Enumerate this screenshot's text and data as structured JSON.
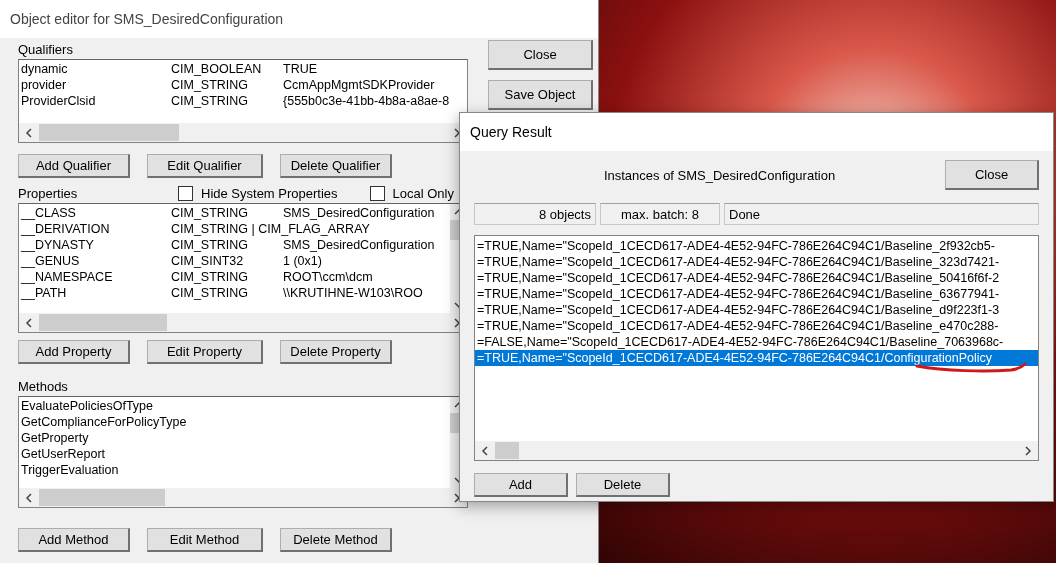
{
  "editor": {
    "title": "Object editor for SMS_DesiredConfiguration",
    "side_buttons": [
      "Close",
      "Save Object"
    ],
    "qualifiers": {
      "label": "Qualifiers",
      "rows": [
        {
          "name": "dynamic",
          "type": "CIM_BOOLEAN",
          "value": "TRUE"
        },
        {
          "name": "provider",
          "type": "CIM_STRING",
          "value": "CcmAppMgmtSDKProvider"
        },
        {
          "name": "ProviderClsid",
          "type": "CIM_STRING",
          "value": "{555b0c3e-41bb-4b8a-a8ae-8"
        }
      ],
      "buttons": [
        "Add Qualifier",
        "Edit Qualifier",
        "Delete Qualifier"
      ]
    },
    "properties": {
      "label": "Properties",
      "options": [
        {
          "label": "Hide System Properties",
          "checked": false
        },
        {
          "label": "Local Only",
          "checked": false
        }
      ],
      "rows": [
        {
          "name": "__CLASS",
          "type": "CIM_STRING",
          "value": "SMS_DesiredConfiguration"
        },
        {
          "name": "__DERIVATION",
          "type": "CIM_STRING | CIM_FLAG_ARRAY",
          "value": ""
        },
        {
          "name": "__DYNASTY",
          "type": "CIM_STRING",
          "value": "SMS_DesiredConfiguration"
        },
        {
          "name": "__GENUS",
          "type": "CIM_SINT32",
          "value": "1 (0x1)"
        },
        {
          "name": "__NAMESPACE",
          "type": "CIM_STRING",
          "value": "ROOT\\ccm\\dcm"
        },
        {
          "name": "__PATH",
          "type": "CIM_STRING",
          "value": "\\\\KRUTIHNE-W103\\ROO"
        }
      ],
      "buttons": [
        "Add Property",
        "Edit Property",
        "Delete Property"
      ]
    },
    "methods": {
      "label": "Methods",
      "rows": [
        "EvaluatePoliciesOfType",
        "GetComplianceForPolicyType",
        "GetProperty",
        "GetUserReport",
        "TriggerEvaluation"
      ],
      "buttons": [
        "Add Method",
        "Edit Method",
        "Delete Method"
      ]
    }
  },
  "query": {
    "title": "Query Result",
    "heading": "Instances of SMS_DesiredConfiguration",
    "close": "Close",
    "status": [
      "8 objects",
      "max. batch: 8",
      "Done"
    ],
    "rows": [
      {
        "text": "=TRUE,Name=\"ScopeId_1CECD617-ADE4-4E52-94FC-786E264C94C1/Baseline_2f932cb5-",
        "selected": false
      },
      {
        "text": "=TRUE,Name=\"ScopeId_1CECD617-ADE4-4E52-94FC-786E264C94C1/Baseline_323d7421-",
        "selected": false
      },
      {
        "text": "=TRUE,Name=\"ScopeId_1CECD617-ADE4-4E52-94FC-786E264C94C1/Baseline_50416f6f-2",
        "selected": false
      },
      {
        "text": "=TRUE,Name=\"ScopeId_1CECD617-ADE4-4E52-94FC-786E264C94C1/Baseline_63677941-",
        "selected": false
      },
      {
        "text": "=TRUE,Name=\"ScopeId_1CECD617-ADE4-4E52-94FC-786E264C94C1/Baseline_d9f223f1-3",
        "selected": false
      },
      {
        "text": "=TRUE,Name=\"ScopeId_1CECD617-ADE4-4E52-94FC-786E264C94C1/Baseline_e470c288-",
        "selected": false
      },
      {
        "text": "=FALSE,Name=\"ScopeId_1CECD617-ADE4-4E52-94FC-786E264C94C1/Baseline_7063968c-",
        "selected": false
      },
      {
        "text": "=TRUE,Name=\"ScopeId_1CECD617-ADE4-4E52-94FC-786E264C94C1/ConfigurationPolicy",
        "selected": true
      }
    ],
    "buttons": [
      "Add",
      "Delete"
    ]
  }
}
